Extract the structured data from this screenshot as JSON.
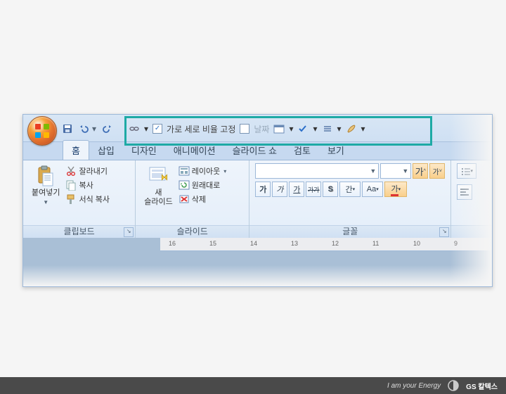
{
  "qat_text": {
    "aspect_lock": "가로 세로 비율 고정",
    "date": "날짜"
  },
  "tabs": [
    "홈",
    "삽입",
    "디자인",
    "애니메이션",
    "슬라이드 쇼",
    "검토",
    "보기"
  ],
  "active_tab": 0,
  "clipboard": {
    "paste": "붙여넣기",
    "cut": "잘라내기",
    "copy": "복사",
    "format_painter": "서식 복사",
    "group_label": "클립보드"
  },
  "slides": {
    "new_slide": "새\n슬라이드",
    "layout": "레이아웃",
    "reset": "원래대로",
    "delete": "삭제",
    "group_label": "슬라이드"
  },
  "font": {
    "family_placeholder": "",
    "size_placeholder": "",
    "bold": "가",
    "italic": "가",
    "underline": "가",
    "strike": "가가",
    "shadow": "S",
    "spacing": "간",
    "change_case": "Aa",
    "color": "가",
    "group_label": "글꼴"
  },
  "ruler_marks": [
    "16",
    "15",
    "14",
    "13",
    "12",
    "11",
    "10",
    "9"
  ],
  "footer": {
    "slogan": "I am your Energy",
    "brand": "GS 칼텍스"
  }
}
